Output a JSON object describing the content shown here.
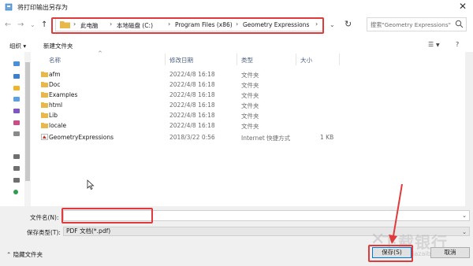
{
  "window": {
    "title": "将打印输出另存为"
  },
  "address": {
    "crumbs": [
      "此电脑",
      "本地磁盘 (C:)",
      "Program Files (x86)",
      "Geometry Expressions"
    ]
  },
  "search": {
    "placeholder": "搜索\"Geometry Expressions\""
  },
  "toolbar": {
    "organize": "组织 ▾",
    "new_folder": "新建文件夹"
  },
  "columns": {
    "name": "名称",
    "modified": "修改日期",
    "type": "类型",
    "size": "大小"
  },
  "files": [
    {
      "name": "afm",
      "date": "2022/4/8 16:18",
      "type": "文件夹",
      "size": "",
      "kind": "folder"
    },
    {
      "name": "Doc",
      "date": "2022/4/8 16:18",
      "type": "文件夹",
      "size": "",
      "kind": "folder"
    },
    {
      "name": "Examples",
      "date": "2022/4/8 16:18",
      "type": "文件夹",
      "size": "",
      "kind": "folder"
    },
    {
      "name": "html",
      "date": "2022/4/8 16:18",
      "type": "文件夹",
      "size": "",
      "kind": "folder"
    },
    {
      "name": "Lib",
      "date": "2022/4/8 16:18",
      "type": "文件夹",
      "size": "",
      "kind": "folder"
    },
    {
      "name": "locale",
      "date": "2022/4/8 16:18",
      "type": "文件夹",
      "size": "",
      "kind": "folder"
    },
    {
      "name": "GeometryExpressions",
      "date": "2018/3/22 0:56",
      "type": "Internet 快捷方式",
      "size": "1 KB",
      "kind": "shortcut"
    }
  ],
  "form": {
    "filename_label": "文件名(N):",
    "filename_value": "",
    "filetype_label": "保存类型(T):",
    "filetype_value": "PDF 文档(*.pdf)"
  },
  "footer": {
    "hide_folders": "隐藏文件夹",
    "save": "保存(S)",
    "cancel": "取消"
  },
  "watermark": {
    "text": "下载银行",
    "url": "www.xiazaibank.cn"
  },
  "colors": {
    "highlight": "#e03a3a",
    "folder": "#e8b94a",
    "accent": "#0078d7"
  }
}
